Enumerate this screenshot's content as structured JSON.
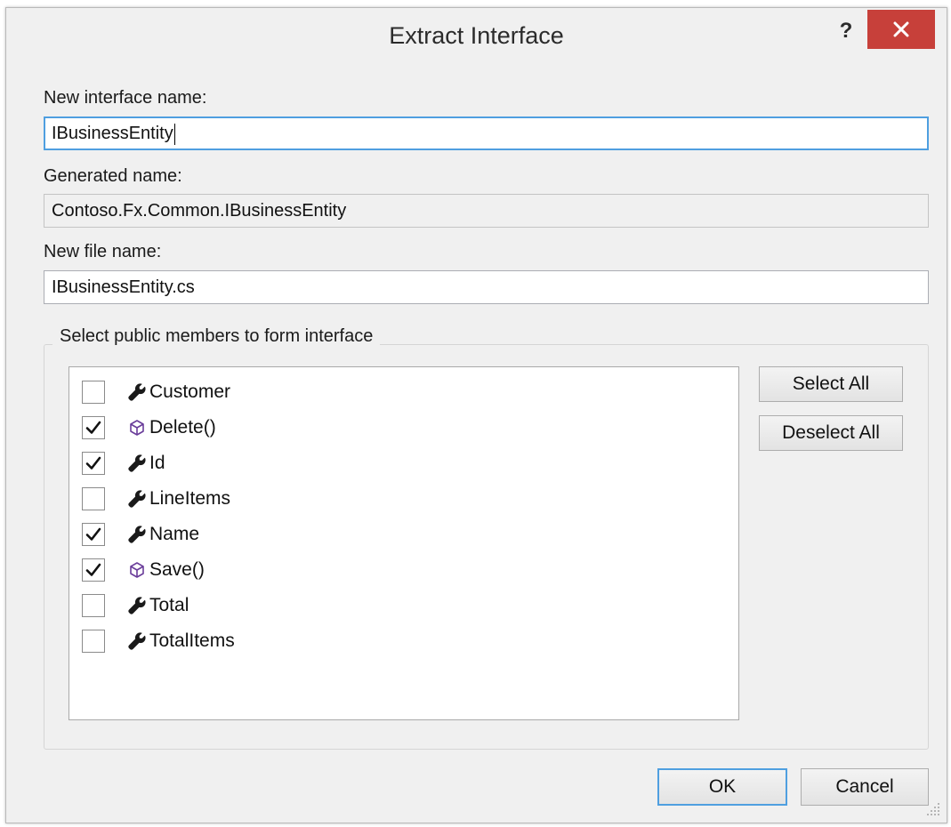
{
  "window": {
    "title": "Extract Interface",
    "help_label": "?"
  },
  "fields": {
    "interface_name_label": "New interface name:",
    "interface_name_value": "IBusinessEntity",
    "generated_name_label": "Generated name:",
    "generated_name_value": "Contoso.Fx.Common.IBusinessEntity",
    "file_name_label": "New file name:",
    "file_name_value": "IBusinessEntity.cs"
  },
  "members_group": {
    "title": "Select public members to form interface",
    "items": [
      {
        "label": "Customer",
        "checked": false,
        "icon": "wrench-icon"
      },
      {
        "label": "Delete()",
        "checked": true,
        "icon": "method-cube-icon"
      },
      {
        "label": "Id",
        "checked": true,
        "icon": "wrench-icon"
      },
      {
        "label": "LineItems",
        "checked": false,
        "icon": "wrench-icon"
      },
      {
        "label": "Name",
        "checked": true,
        "icon": "wrench-icon"
      },
      {
        "label": "Save()",
        "checked": true,
        "icon": "method-cube-icon"
      },
      {
        "label": "Total",
        "checked": false,
        "icon": "wrench-icon"
      },
      {
        "label": "TotalItems",
        "checked": false,
        "icon": "wrench-icon"
      }
    ]
  },
  "buttons": {
    "select_all": "Select All",
    "deselect_all": "Deselect All",
    "ok": "OK",
    "cancel": "Cancel"
  },
  "colors": {
    "close_button": "#c7403a",
    "focus_border": "#4f9fe0",
    "method_icon": "#6a3d9a"
  }
}
